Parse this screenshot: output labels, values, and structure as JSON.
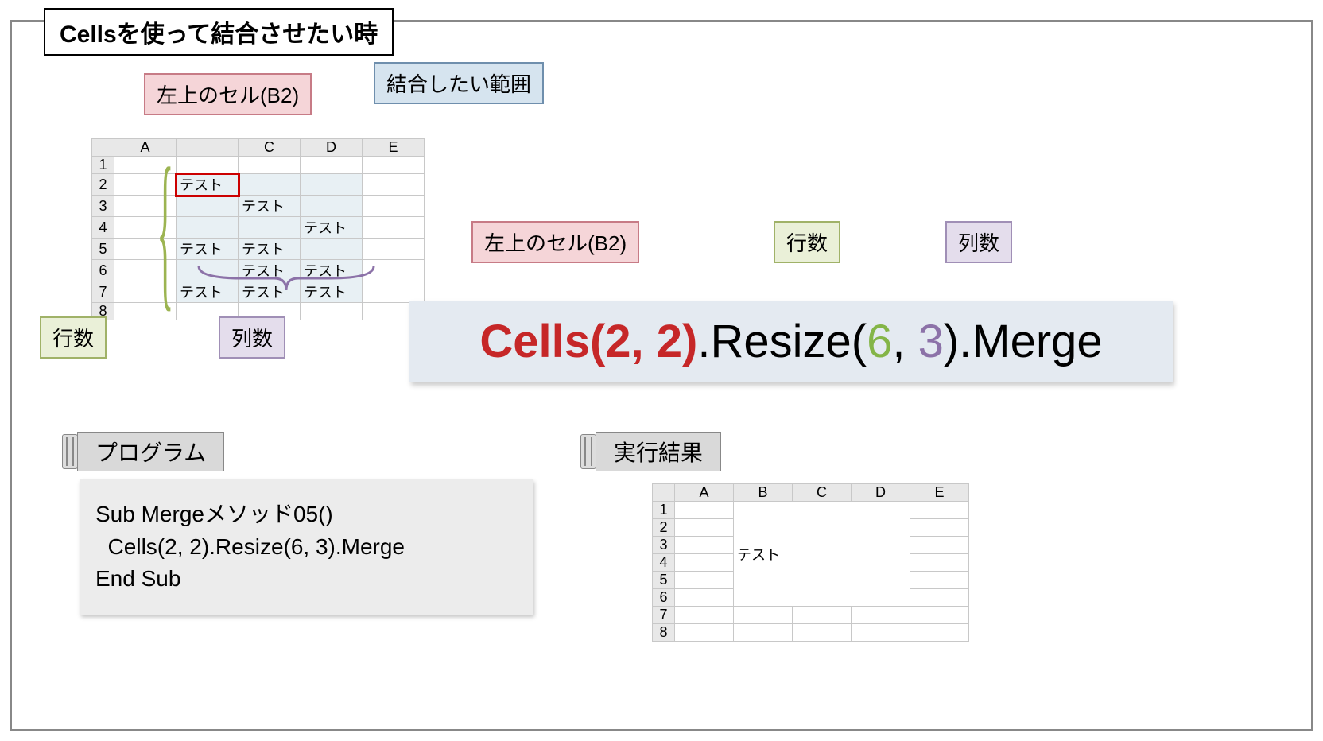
{
  "title": "Cellsを使って結合させたい時",
  "callouts": {
    "topLeftCell": "左上のセル(B2)",
    "mergeRange": "結合したい範囲",
    "rowCount": "行数",
    "colCount": "列数"
  },
  "sheet1": {
    "cols": [
      "A",
      "",
      "C",
      "D",
      "E"
    ],
    "rows": [
      "1",
      "2",
      "3",
      "4",
      "5",
      "6",
      "7",
      "8"
    ],
    "cells": {
      "b2": "テスト",
      "c3": "テスト",
      "d4": "テスト",
      "b5": "テスト",
      "c5": "テスト",
      "c6": "テスト",
      "d6": "テスト",
      "b7": "テスト",
      "c7": "テスト",
      "d7": "テスト"
    }
  },
  "formula": {
    "cells": "Cells(2, 2)",
    "resize": ".Resize(",
    "six": "6",
    "comma": ", ",
    "three": "3",
    "end": ").Merge"
  },
  "programHeader": "プログラム",
  "resultHeader": "実行結果",
  "code": {
    "l1": "Sub Mergeメソッド05()",
    "l2": "  Cells(2, 2).Resize(6, 3).Merge",
    "l3": "End Sub"
  },
  "sheet2": {
    "cols": [
      "A",
      "B",
      "C",
      "D",
      "E"
    ],
    "rows": [
      "1",
      "2",
      "3",
      "4",
      "5",
      "6",
      "7",
      "8"
    ],
    "merged": "テスト"
  }
}
